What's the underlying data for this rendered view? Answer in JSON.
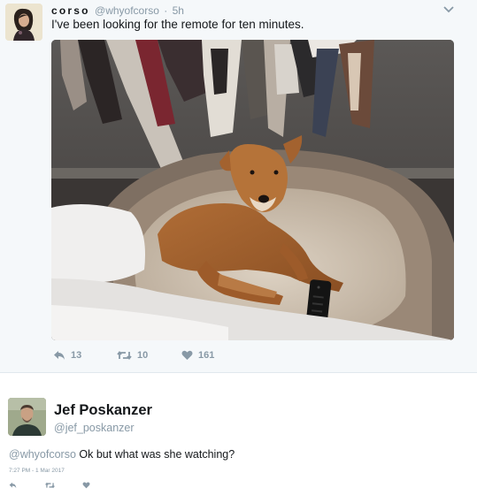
{
  "original_tweet": {
    "display_name": "corso",
    "handle": "@whyofcorso",
    "time": "5h",
    "text": "I've been looking for the remote for ten minutes.",
    "avatar_icon": "profile-photo-woman",
    "photo_icon": "dog-on-bed-photo",
    "actions": {
      "reply_count": "13",
      "retweet_count": "10",
      "like_count": "161"
    }
  },
  "reply_tweet": {
    "display_name": "Jef Poskanzer",
    "handle": "@jef_poskanzer",
    "mention": "@whyofcorso",
    "text": "Ok but what was she watching?",
    "timestamp": "7:27 PM - 1 Mar 2017",
    "avatar_icon": "profile-photo-man"
  },
  "colors": {
    "text": "#14171a",
    "secondary": "#8899a6",
    "background_highlight": "#f5f8fa",
    "border": "#e1e8ed"
  }
}
